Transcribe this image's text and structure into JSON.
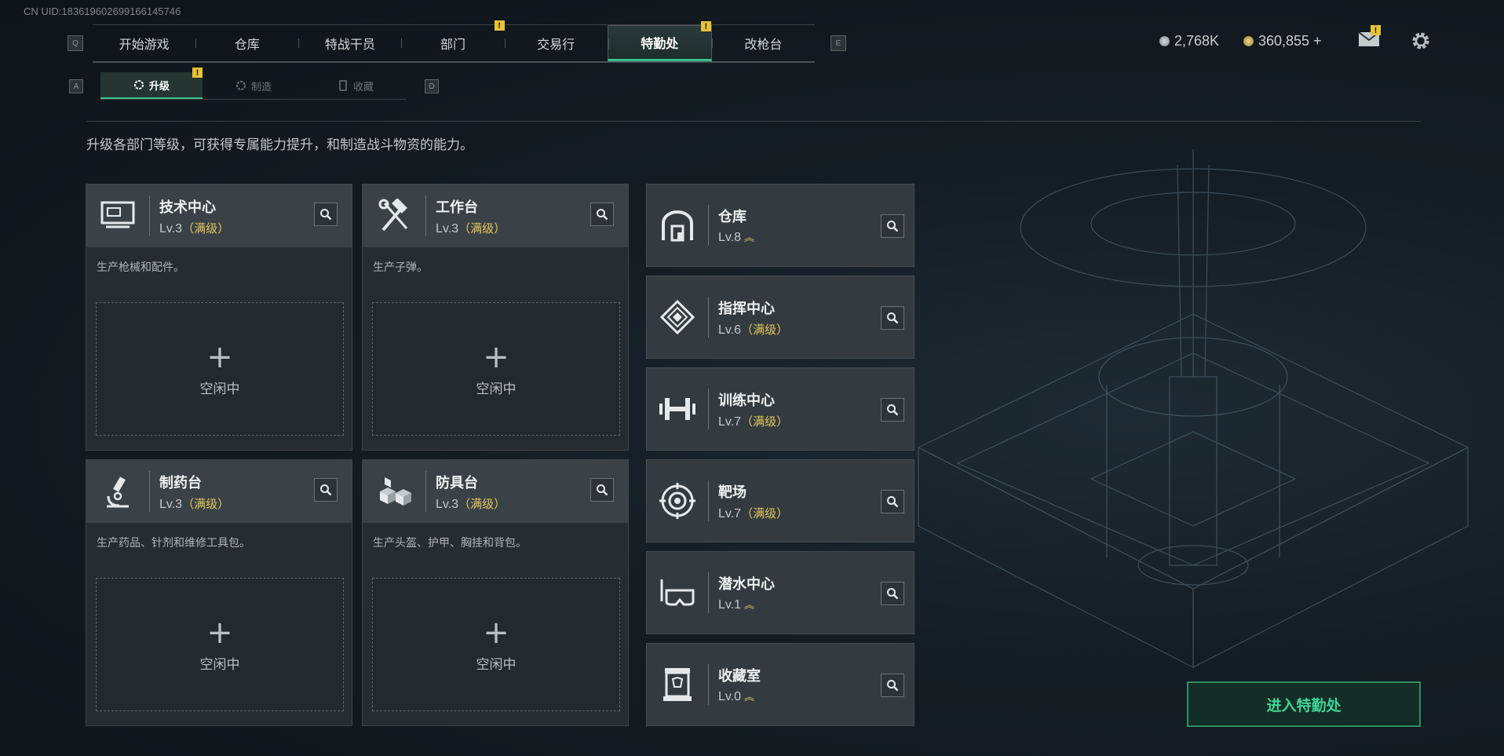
{
  "uid": "CN UID:18361960269916614574б",
  "key_hints": {
    "q": "Q",
    "e": "E",
    "a": "A",
    "d": "D"
  },
  "top_tabs": [
    {
      "label": "开始游戏"
    },
    {
      "label": "仓库"
    },
    {
      "label": "特战干员"
    },
    {
      "label": "部门"
    },
    {
      "label": "交易行"
    },
    {
      "label": "特勤处",
      "active": true
    },
    {
      "label": "改枪台"
    }
  ],
  "badge_mark": "!",
  "currency": {
    "silver": "2,768K",
    "gold": "360,855 +"
  },
  "sub_tabs": [
    {
      "label": "升级",
      "active": true
    },
    {
      "label": "制造"
    },
    {
      "label": "收藏"
    }
  ],
  "description": "升级各部门等级，可获得专属能力提升，和制造战斗物资的能力。",
  "workstations": [
    {
      "name": "技术中心",
      "level": "Lv.3",
      "status": "（满级）",
      "desc": "生产枪械和配件。",
      "slot_text": "空闲中",
      "icon": "computer-icon"
    },
    {
      "name": "工作台",
      "level": "Lv.3",
      "status": "（满级）",
      "desc": "生产子弹。",
      "slot_text": "空闲中",
      "icon": "hammer-wrench-icon"
    },
    {
      "name": "制药台",
      "level": "Lv.3",
      "status": "（满级）",
      "desc": "生产药品、针剂和维修工具包。",
      "slot_text": "空闲中",
      "icon": "microscope-icon"
    },
    {
      "name": "防具台",
      "level": "Lv.3",
      "status": "（满级）",
      "desc": "生产头盔、护甲、胸挂和背包。",
      "slot_text": "空闲中",
      "icon": "cubes-icon"
    }
  ],
  "departments": [
    {
      "name": "仓库",
      "level": "Lv.8",
      "status": "",
      "upgradable": true,
      "icon": "warehouse-icon"
    },
    {
      "name": "指挥中心",
      "level": "Lv.6",
      "status": "（满级）",
      "upgradable": false,
      "icon": "command-icon"
    },
    {
      "name": "训练中心",
      "level": "Lv.7",
      "status": "（满级）",
      "upgradable": false,
      "icon": "dumbbell-icon"
    },
    {
      "name": "靶场",
      "level": "Lv.7",
      "status": "（满级）",
      "upgradable": false,
      "icon": "target-icon"
    },
    {
      "name": "潜水中心",
      "level": "Lv.1",
      "status": "",
      "upgradable": true,
      "icon": "diving-mask-icon"
    },
    {
      "name": "收藏室",
      "level": "Lv.0",
      "status": "",
      "upgradable": true,
      "icon": "trophy-case-icon"
    }
  ],
  "enter_button": "进入特勤处",
  "colors": {
    "accent": "#38c48a",
    "max_level": "#e4c65a",
    "badge": "#e8c234"
  }
}
